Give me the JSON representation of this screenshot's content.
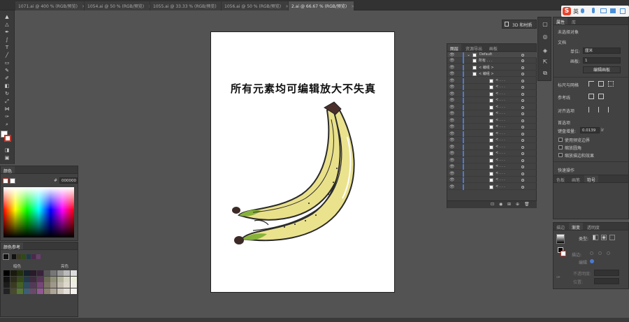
{
  "document_tabs": [
    {
      "label": "1071.ai @ 400 % (RGB/预览)",
      "active": false
    },
    {
      "label": "1054.ai @ 50 % (RGB/预览)",
      "active": false
    },
    {
      "label": "1055.ai @ 33.33 % (RGB/预览)",
      "active": false
    },
    {
      "label": "1056.ai @ 50 % (RGB/预览)",
      "active": false
    },
    {
      "label": "2.ai @ 66.67 % (RGB/预览)",
      "active": true
    }
  ],
  "tab_close_glyph": "×",
  "ime_bar": {
    "logo": "S",
    "lang": "英"
  },
  "artboard": {
    "title": "所有元素均可编辑放大不失真"
  },
  "float_button": {
    "label": "3D 和材质"
  },
  "layers_panel": {
    "tabs": [
      "图层",
      "资源导出",
      "画板"
    ],
    "layer_default": "Default",
    "rows": [
      {
        "name": "所有 . . .",
        "indent": 1
      },
      {
        "name": "< 编组 >",
        "indent": 1
      },
      {
        "name": "< 编组 >",
        "indent": 1
      },
      {
        "name": "< . . .",
        "indent": 2
      },
      {
        "name": "< . . .",
        "indent": 2
      },
      {
        "name": "< . . .",
        "indent": 2
      },
      {
        "name": "< . . .",
        "indent": 2
      },
      {
        "name": "< . . .",
        "indent": 2
      },
      {
        "name": "< . . .",
        "indent": 2
      },
      {
        "name": "< . . .",
        "indent": 2
      },
      {
        "name": "< . . .",
        "indent": 2
      },
      {
        "name": "< . . .",
        "indent": 2
      },
      {
        "name": "< . . .",
        "indent": 2
      },
      {
        "name": "< . . .",
        "indent": 2
      },
      {
        "name": "< . . .",
        "indent": 2
      },
      {
        "name": "< . . .",
        "indent": 2
      },
      {
        "name": "< . . .",
        "indent": 2
      },
      {
        "name": "< . . .",
        "indent": 2
      },
      {
        "name": "< . . .",
        "indent": 2
      },
      {
        "name": "< . . .",
        "indent": 2
      }
    ]
  },
  "color_panel": {
    "title": "颜色",
    "hex_prefix": "#",
    "hex": "000000"
  },
  "color_guide_panel": {
    "title": "颜色参考",
    "left_label": "暗色",
    "right_label": "亮色"
  },
  "properties_panel": {
    "tabs": [
      "属性",
      "库"
    ],
    "no_selection": "未选择对象",
    "document_label": "文档",
    "units_label": "单位:",
    "units_value": "厘米",
    "artboard_label": "画板:",
    "artboard_value": "1",
    "edit_artboard_btn": "编辑画板",
    "ruler_grid": "标尺与网格",
    "guides": "参考线",
    "snap": "对齐选项",
    "preferences": "首选项",
    "keyboard_increment_label": "键盘增量:",
    "keyboard_increment_value": "0.0139",
    "keyboard_increment_unit": "ir",
    "cb_preview_bounds": "使用预览边界",
    "cb_scale_corners": "缩放圆角",
    "cb_scale_strokes": "缩放描边和效果",
    "quick_actions": "快速操作"
  },
  "swatches_panel": {
    "tabs": [
      "色板",
      "画笔",
      "符号"
    ]
  },
  "gradient_panel": {
    "tabs": [
      "描边",
      "渐变",
      "透明度"
    ],
    "type_label": "类型:",
    "stroke_label": "描边:",
    "angle_label": "不透明度:",
    "location_label": "位置:",
    "edit_label": "编辑"
  },
  "colors": {
    "banana_yellow": "#e9e08a",
    "banana_outline": "#2a2a2a",
    "banana_tip": "#4a2f2a",
    "banana_green": "#86b33a",
    "accent_blue": "#4a7bd4",
    "ime_red": "#e8452c"
  }
}
